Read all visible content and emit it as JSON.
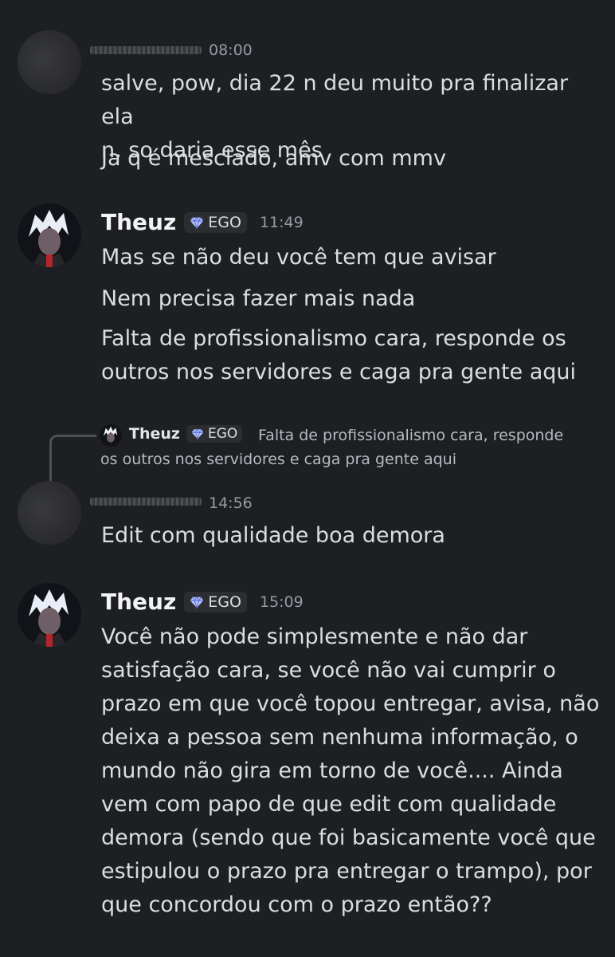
{
  "messages": [
    {
      "time": "08:00",
      "lines": [
        "salve, pow, dia 22 n deu muito pra finalizar ela\nn, so daria esse mês",
        "Ja q é mesclado, amv com mmv"
      ]
    },
    {
      "author": "Theuz",
      "tag": "EGO",
      "time": "11:49",
      "lines": [
        "Mas se não deu você tem que avisar",
        "Nem precisa fazer mais nada",
        "Falta de profissionalismo cara, responde os\noutros nos servidores e caga pra gente aqui"
      ]
    },
    {
      "reply": {
        "author": "Theuz",
        "tag": "EGO",
        "text": "Falta de profissionalismo cara, responde\nos outros nos servidores e caga pra gente aqui"
      },
      "time": "14:56",
      "lines": [
        "Edit com qualidade boa demora"
      ]
    },
    {
      "author": "Theuz",
      "tag": "EGO",
      "time": "15:09",
      "lines": [
        "Você não pode simplesmente e não dar\nsatisfação cara, se você não vai cumprir o\nprazo em que você topou entregar, avisa, não\ndeixa a pessoa sem nenhuma informação, o\nmundo não gira em torno de você.... Ainda\nvem com papo de que edit com qualidade\ndemora (sendo que foi basicamente você que\nestipulou o prazo pra entregar o trampo), por\nque concordou com o prazo então??"
      ]
    }
  ],
  "colors": {
    "background": "#1e1f22",
    "text": "#dbdee1",
    "muted": "#949ba4",
    "tag_bg": "#2b2d31",
    "gem": "#b9c6ff"
  },
  "icons": {
    "gem": "gem-icon",
    "avatar": "avatar"
  }
}
